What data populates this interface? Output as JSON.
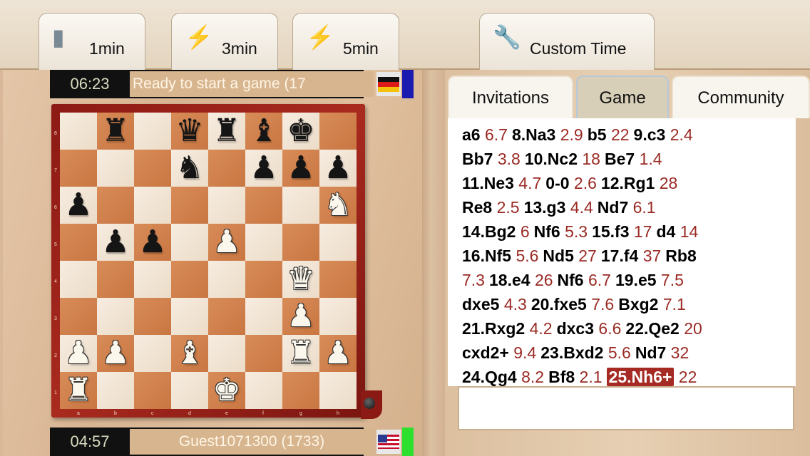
{
  "toolbar": {
    "buttons": [
      {
        "label": "1min",
        "icon": "bullet-icon"
      },
      {
        "label": "3min",
        "icon": "lightning-icon"
      },
      {
        "label": "5min",
        "icon": "lightning-icon"
      },
      {
        "label": "Custom Time",
        "icon": "wrench-icon"
      }
    ]
  },
  "players": {
    "top": {
      "clock": "06:23",
      "name": "Ready to start a game (17",
      "flag": "germany-flag",
      "indicator_color": "#1b1bb0"
    },
    "bottom": {
      "clock": "04:57",
      "name": "Guest1071300 (1733)",
      "flag": "usa-flag",
      "indicator_color": "#2ee02e"
    }
  },
  "board": {
    "files": [
      "a",
      "b",
      "c",
      "d",
      "e",
      "f",
      "g",
      "h"
    ],
    "ranks": [
      "8",
      "7",
      "6",
      "5",
      "4",
      "3",
      "2",
      "1"
    ],
    "position": [
      [
        "",
        "bR",
        "",
        "bQ",
        "bR",
        "bB",
        "bK",
        ""
      ],
      [
        "",
        "",
        "",
        "bN",
        "",
        "bP",
        "bP",
        "bP"
      ],
      [
        "bP",
        "",
        "",
        "",
        "",
        "",
        "",
        "wN"
      ],
      [
        "",
        "bP",
        "bP",
        "",
        "wP",
        "",
        "",
        ""
      ],
      [
        "",
        "",
        "",
        "",
        "",
        "",
        "wQ",
        ""
      ],
      [
        "",
        "",
        "",
        "",
        "",
        "",
        "wP",
        ""
      ],
      [
        "wP",
        "wP",
        "",
        "wB",
        "",
        "",
        "wR",
        "wP"
      ],
      [
        "wR",
        "",
        "",
        "",
        "wK",
        "",
        "",
        ""
      ]
    ]
  },
  "tabs": [
    {
      "label": "Invitations",
      "active": false
    },
    {
      "label": "Game",
      "active": true
    },
    {
      "label": "Community",
      "active": false
    }
  ],
  "moves": [
    [
      {
        "m": "a6",
        "t": "6.7"
      },
      {
        "m": "8.Na3",
        "t": "2.9"
      },
      {
        "m": "b5",
        "t": "22"
      },
      {
        "m": "9.c3",
        "t": "2.4"
      }
    ],
    [
      {
        "m": "Bb7",
        "t": "3.8"
      },
      {
        "m": "10.Nc2",
        "t": "18"
      },
      {
        "m": "Be7",
        "t": "1.4"
      }
    ],
    [
      {
        "m": "11.Ne3",
        "t": "4.7"
      },
      {
        "m": "0-0",
        "t": "2.6"
      },
      {
        "m": "12.Rg1",
        "t": "28"
      }
    ],
    [
      {
        "m": "Re8",
        "t": "2.5"
      },
      {
        "m": "13.g3",
        "t": "4.4"
      },
      {
        "m": "Nd7",
        "t": "6.1"
      }
    ],
    [
      {
        "m": "14.Bg2",
        "t": "6"
      },
      {
        "m": "Nf6",
        "t": "5.3"
      },
      {
        "m": "15.f3",
        "t": "17"
      },
      {
        "m": "d4",
        "t": "14"
      }
    ],
    [
      {
        "m": "16.Nf5",
        "t": "5.6"
      },
      {
        "m": "Nd5",
        "t": "27"
      },
      {
        "m": "17.f4",
        "t": "37"
      },
      {
        "m": "Rb8",
        "t": ""
      }
    ],
    [
      {
        "m": "",
        "t": "7.3"
      },
      {
        "m": "18.e4",
        "t": "26"
      },
      {
        "m": "Nf6",
        "t": "6.7"
      },
      {
        "m": "19.e5",
        "t": "7.5"
      }
    ],
    [
      {
        "m": "dxe5",
        "t": "4.3"
      },
      {
        "m": "20.fxe5",
        "t": "7.6"
      },
      {
        "m": "Bxg2",
        "t": "7.1"
      }
    ],
    [
      {
        "m": "21.Rxg2",
        "t": "4.2"
      },
      {
        "m": "dxc3",
        "t": "6.6"
      },
      {
        "m": "22.Qe2",
        "t": "20"
      }
    ],
    [
      {
        "m": "cxd2+",
        "t": "9.4"
      },
      {
        "m": "23.Bxd2",
        "t": "5.6"
      },
      {
        "m": "Nd7",
        "t": "32"
      }
    ],
    [
      {
        "m": "24.Qg4",
        "t": "8.2"
      },
      {
        "m": "Bf8",
        "t": "2.1"
      },
      {
        "m": "25.Nh6+",
        "t": "22",
        "highlight": true
      }
    ]
  ],
  "chat": {
    "value": ""
  }
}
